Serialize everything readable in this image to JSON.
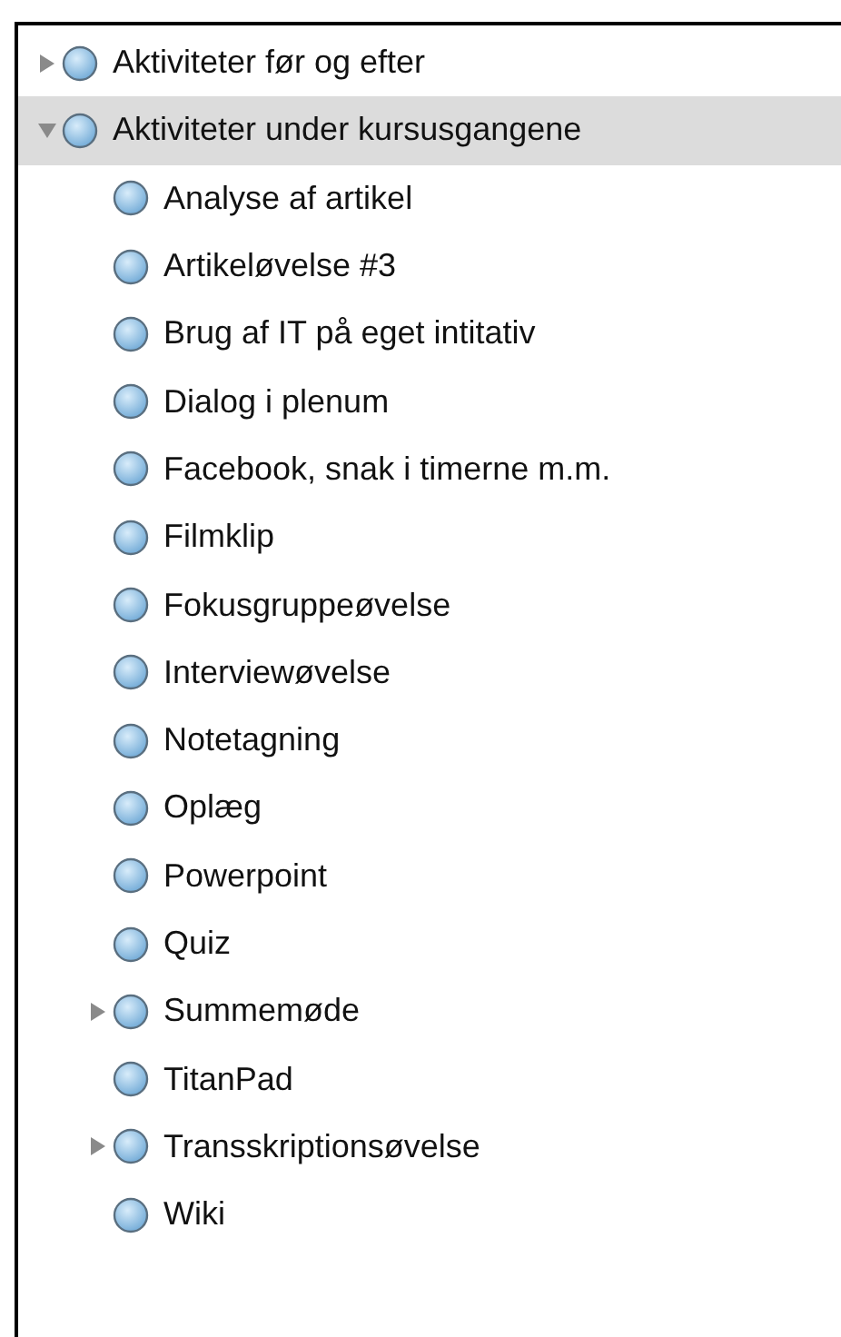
{
  "tree": [
    {
      "label": "Aktiviteter før og efter",
      "expanded": false,
      "selected": false
    },
    {
      "label": "Aktiviteter under kursusgangene",
      "expanded": true,
      "selected": true,
      "children": [
        {
          "label": "Analyse af artikel",
          "selected": false
        },
        {
          "label": "Artikeløvelse #3",
          "selected": false
        },
        {
          "label": "Brug af IT på eget intitativ",
          "selected": false
        },
        {
          "label": "Dialog i plenum",
          "selected": false
        },
        {
          "label": "Facebook, snak i timerne m.m.",
          "selected": false
        },
        {
          "label": "Filmklip",
          "selected": false
        },
        {
          "label": "Fokusgruppeøvelse",
          "selected": false
        },
        {
          "label": "Interviewøvelse",
          "selected": false
        },
        {
          "label": "Notetagning",
          "selected": false
        },
        {
          "label": "Oplæg",
          "selected": false
        },
        {
          "label": "Powerpoint",
          "selected": false
        },
        {
          "label": "Quiz",
          "selected": false
        },
        {
          "label": "Summemøde",
          "expanded": false,
          "selected": false
        },
        {
          "label": "TitanPad",
          "selected": false
        },
        {
          "label": "Transskriptionsøvelse",
          "expanded": false,
          "selected": false
        },
        {
          "label": "Wiki",
          "selected": false
        }
      ]
    }
  ]
}
